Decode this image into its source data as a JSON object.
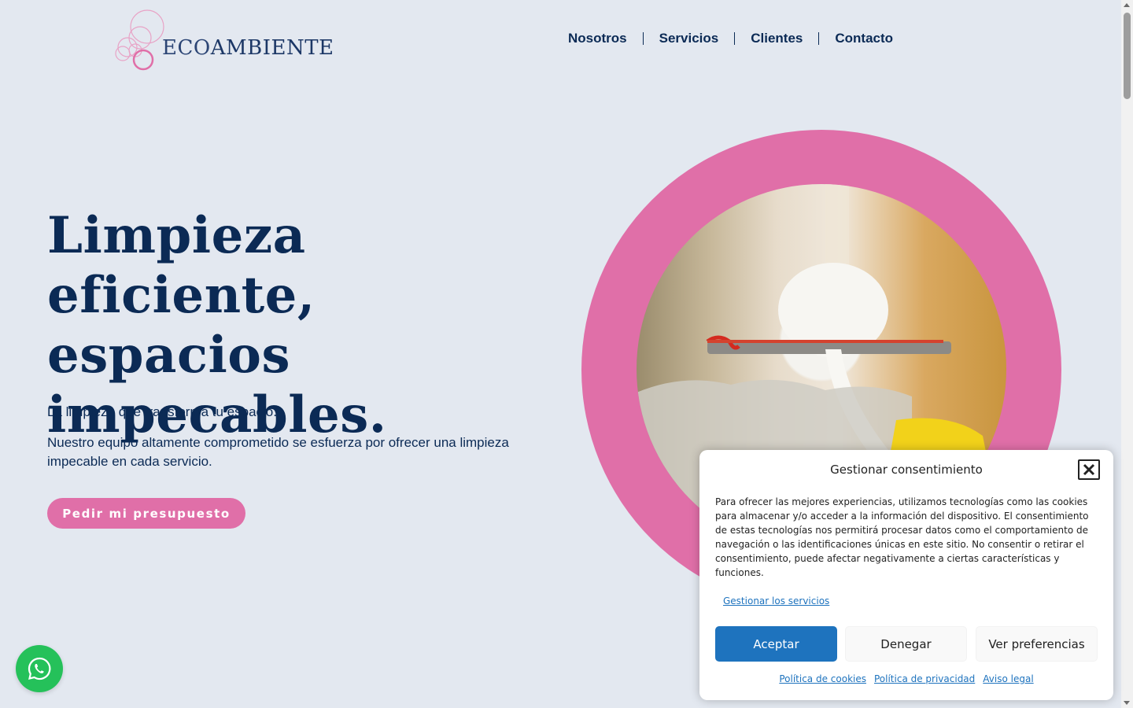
{
  "header": {
    "logo": {
      "eco": "ECO",
      "ambiente": "AMBIENTE"
    },
    "nav": [
      {
        "label": "Nosotros"
      },
      {
        "label": "Servicios"
      },
      {
        "label": "Clientes"
      },
      {
        "label": "Contacto"
      }
    ]
  },
  "hero": {
    "title_line1": "Limpieza eficiente,",
    "title_line2": "espacios",
    "title_line3": "impecables.",
    "subtitle": "La limpieza que transforma tu espacio.",
    "description": "Nuestro equipo altamente comprometido se esfuerza por ofrecer una limpieza impecable en cada servicio.",
    "cta_label": "Pedir mi presupuesto"
  },
  "consent": {
    "title": "Gestionar consentimiento",
    "body": "Para ofrecer las mejores experiencias, utilizamos tecnologías como las cookies para almacenar y/o acceder a la información del dispositivo. El consentimiento de estas tecnologías nos permitirá procesar datos como el comportamiento de navegación o las identificaciones únicas en este sitio. No consentir o retirar el consentimiento, puede afectar negativamente a ciertas características y funciones.",
    "manage_link": "Gestionar los servicios",
    "accept": "Aceptar",
    "deny": "Denegar",
    "preferences": "Ver preferencias",
    "links": {
      "cookies": "Política de cookies",
      "privacy": "Política de privacidad",
      "legal": "Aviso legal"
    }
  },
  "colors": {
    "background": "#e3e8f0",
    "navy": "#0b2a55",
    "pink": "#e06fa8",
    "whatsapp_green": "#25c15a",
    "consent_blue": "#1e73be"
  },
  "icons": {
    "whatsapp": "whatsapp-icon",
    "close": "close-icon"
  }
}
